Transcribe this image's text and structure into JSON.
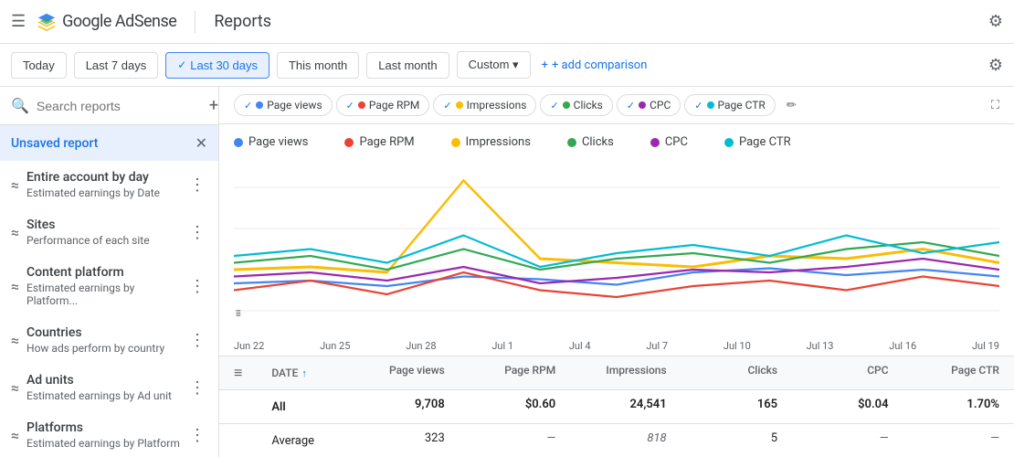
{
  "header": {
    "menu_label": "☰",
    "brand": "Google AdSense",
    "divider": true,
    "title": "Reports",
    "settings_label": "⚙"
  },
  "filter_bar": {
    "buttons": [
      {
        "id": "today",
        "label": "Today",
        "active": false
      },
      {
        "id": "last7",
        "label": "Last 7 days",
        "active": false
      },
      {
        "id": "last30",
        "label": "Last 30 days",
        "active": true
      },
      {
        "id": "thismonth",
        "label": "This month",
        "active": false
      },
      {
        "id": "lastmonth",
        "label": "Last month",
        "active": false
      },
      {
        "id": "custom",
        "label": "Custom ▾",
        "active": false
      }
    ],
    "add_comparison": "+ add comparison"
  },
  "sidebar": {
    "search_placeholder": "Search reports",
    "items": [
      {
        "id": "unsaved",
        "label": "Unsaved report",
        "subtitle": "",
        "icon": "",
        "active": true,
        "closeable": true
      },
      {
        "id": "entire-account",
        "label": "Entire account by day",
        "subtitle": "Estimated earnings by Date",
        "icon": "≈",
        "active": false,
        "closeable": false
      },
      {
        "id": "sites",
        "label": "Sites",
        "subtitle": "Performance of each site",
        "icon": "≈",
        "active": false,
        "closeable": false
      },
      {
        "id": "content-platform",
        "label": "Content platform",
        "subtitle": "Estimated earnings by Platform...",
        "icon": "≈",
        "active": false,
        "closeable": false
      },
      {
        "id": "countries",
        "label": "Countries",
        "subtitle": "How ads perform by country",
        "icon": "≈",
        "active": false,
        "closeable": false
      },
      {
        "id": "ad-units",
        "label": "Ad units",
        "subtitle": "Estimated earnings by Ad unit",
        "icon": "≈",
        "active": false,
        "closeable": false
      },
      {
        "id": "platforms",
        "label": "Platforms",
        "subtitle": "Estimated earnings by Platform",
        "icon": "≈",
        "active": false,
        "closeable": false
      }
    ]
  },
  "chart_filters": {
    "chips": [
      {
        "id": "pageviews",
        "label": "Page views",
        "color": "#4285f4",
        "checked": true
      },
      {
        "id": "pagerpm",
        "label": "Page RPM",
        "color": "#ea4335",
        "checked": true
      },
      {
        "id": "impressions",
        "label": "Impressions",
        "color": "#fbbc04",
        "checked": true
      },
      {
        "id": "clicks",
        "label": "Clicks",
        "color": "#34a853",
        "checked": true
      },
      {
        "id": "cpc",
        "label": "CPC",
        "color": "#9c27b0",
        "checked": true
      },
      {
        "id": "pagectr",
        "label": "Page CTR",
        "color": "#00bcd4",
        "checked": true
      }
    ],
    "edit_label": "✏",
    "expand_label": "⛶"
  },
  "chart_legend": {
    "items": [
      {
        "label": "Page views",
        "color": "#4285f4"
      },
      {
        "label": "Page RPM",
        "color": "#ea4335"
      },
      {
        "label": "Impressions",
        "color": "#fbbc04"
      },
      {
        "label": "Clicks",
        "color": "#34a853"
      },
      {
        "label": "CPC",
        "color": "#9c27b0"
      },
      {
        "label": "Page CTR",
        "color": "#00bcd4"
      }
    ]
  },
  "x_axis": {
    "labels": [
      "Jun 22",
      "Jun 25",
      "Jun 28",
      "Jul 1",
      "Jul 4",
      "Jul 7",
      "Jul 10",
      "Jul 13",
      "Jul 16",
      "Jul 19"
    ]
  },
  "table": {
    "columns": [
      {
        "id": "date",
        "label": "DATE",
        "sortable": true
      },
      {
        "id": "pageviews",
        "label": "Page views"
      },
      {
        "id": "pagerpm",
        "label": "Page RPM"
      },
      {
        "id": "impressions",
        "label": "Impressions"
      },
      {
        "id": "clicks",
        "label": "Clicks"
      },
      {
        "id": "cpc",
        "label": "CPC"
      },
      {
        "id": "pagectr",
        "label": "Page CTR"
      }
    ],
    "rows": [
      {
        "date": "All",
        "pageviews": "9,708",
        "pagerpm": "$0.60",
        "impressions": "24,541",
        "clicks": "165",
        "cpc": "$0.04",
        "pagectr": "1.70%",
        "bold": true
      },
      {
        "date": "Average",
        "pageviews": "323",
        "pagerpm": "—",
        "impressions": "818",
        "clicks": "5",
        "cpc": "—",
        "pagectr": "—",
        "bold": false
      }
    ]
  },
  "colors": {
    "pageviews": "#4285f4",
    "pagerpm": "#ea4335",
    "impressions": "#fbbc04",
    "clicks": "#34a853",
    "cpc": "#9c27b0",
    "pagectr": "#00bcd4"
  }
}
